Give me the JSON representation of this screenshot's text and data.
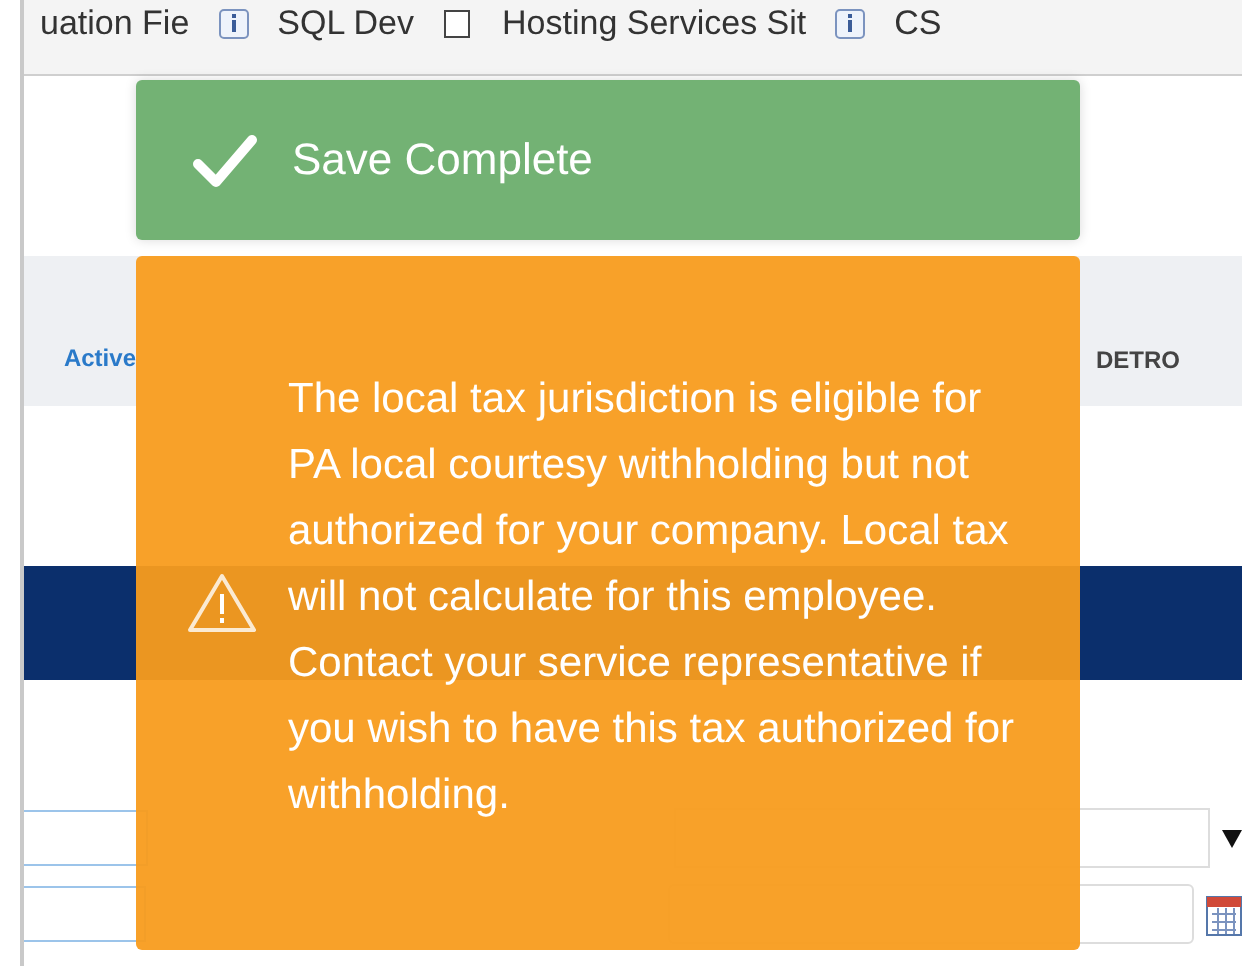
{
  "bookmarks": [
    {
      "label": "uation Fie",
      "kind": "link"
    },
    {
      "label": "SQL Dev",
      "kind": "info"
    },
    {
      "label": "Hosting Services Sit",
      "kind": "page"
    },
    {
      "label": "CS",
      "kind": "info"
    }
  ],
  "employee_summary": {
    "status": "Active",
    "work_location": "DETRO"
  },
  "form_fields": [
    {
      "kind": "select"
    },
    {
      "kind": "date"
    }
  ],
  "toasts": [
    {
      "kind": "success",
      "message": "Save Complete"
    },
    {
      "kind": "warning",
      "message": "The local tax jurisdiction is eligible for PA local courtesy withholding but not authorized for your company. Local tax will not calculate for this employee. Contact your service representative if you wish to have this tax authorized for withholding."
    }
  ]
}
